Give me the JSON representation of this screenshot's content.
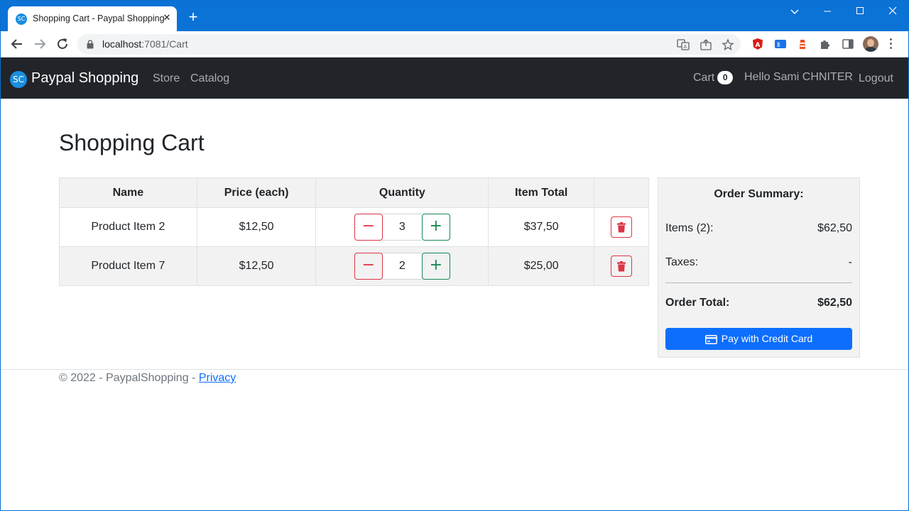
{
  "browser": {
    "tab_title": "Shopping Cart - Paypal Shopping",
    "tab_favicon": "SC",
    "url_host": "localhost",
    "url_rest": ":7081/Cart"
  },
  "navbar": {
    "logo": "SC",
    "brand": "Paypal Shopping",
    "links": [
      "Store",
      "Catalog"
    ],
    "cart_label": "Cart",
    "cart_count": "0",
    "greeting": "Hello Sami CHNITER",
    "logout": "Logout"
  },
  "page": {
    "title": "Shopping Cart"
  },
  "cart": {
    "headers": [
      "Name",
      "Price (each)",
      "Quantity",
      "Item Total",
      ""
    ],
    "rows": [
      {
        "name": "Product Item 2",
        "price": "$12,50",
        "qty": "3",
        "total": "$37,50"
      },
      {
        "name": "Product Item 7",
        "price": "$12,50",
        "qty": "2",
        "total": "$25,00"
      }
    ]
  },
  "summary": {
    "title": "Order Summary:",
    "items_label": "Items (2):",
    "items_value": "$62,50",
    "taxes_label": "Taxes:",
    "taxes_value": "-",
    "total_label": "Order Total:",
    "total_value": "$62,50",
    "pay_button": "Pay with Credit Card"
  },
  "footer": {
    "text": "© 2022 - PaypalShopping - ",
    "privacy": "Privacy"
  },
  "colors": {
    "accent": "#0d6efd",
    "danger": "#dc3545",
    "success": "#198754",
    "navbar": "#212529",
    "titlebar": "#0b72d6"
  }
}
